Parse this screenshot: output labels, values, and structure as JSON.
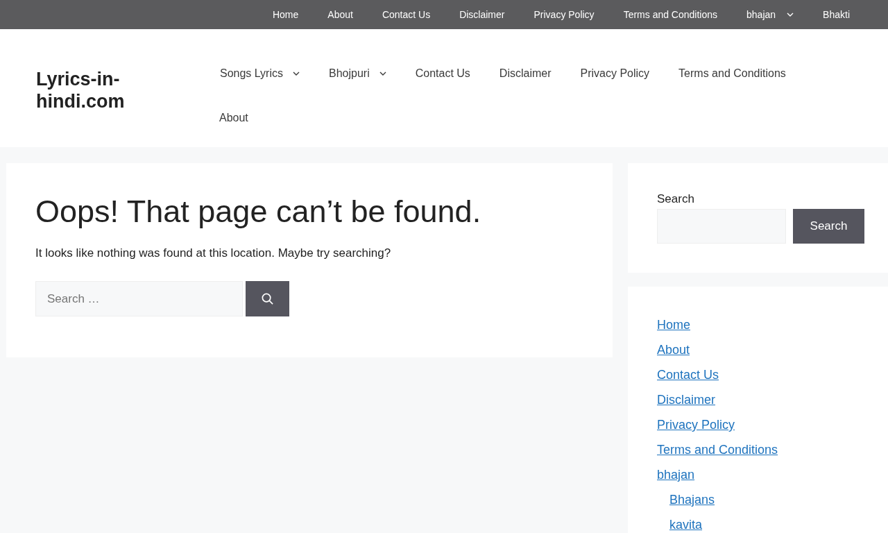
{
  "top_bar": {
    "items": [
      {
        "label": "Home",
        "has_submenu": false
      },
      {
        "label": "About",
        "has_submenu": false
      },
      {
        "label": "Contact Us",
        "has_submenu": false
      },
      {
        "label": "Disclaimer",
        "has_submenu": false
      },
      {
        "label": "Privacy Policy",
        "has_submenu": false
      },
      {
        "label": "Terms and Conditions",
        "has_submenu": false
      },
      {
        "label": "bhajan",
        "has_submenu": true
      },
      {
        "label": "Bhakti",
        "has_submenu": false
      }
    ]
  },
  "header": {
    "site_title": "Lyrics-in-hindi.com",
    "nav": [
      {
        "label": "Songs Lyrics",
        "has_submenu": true
      },
      {
        "label": "Bhojpuri",
        "has_submenu": true
      },
      {
        "label": "Contact Us",
        "has_submenu": false
      },
      {
        "label": "Disclaimer",
        "has_submenu": false
      },
      {
        "label": "Privacy Policy",
        "has_submenu": false
      },
      {
        "label": "Terms and Conditions",
        "has_submenu": false
      },
      {
        "label": "About",
        "has_submenu": false
      }
    ]
  },
  "main": {
    "heading": "Oops! That page can’t be found.",
    "message": "It looks like nothing was found at this location. Maybe try searching?",
    "search": {
      "placeholder": "Search …"
    }
  },
  "sidebar": {
    "search_widget": {
      "label": "Search",
      "button": "Search"
    },
    "pages": [
      {
        "label": "Home"
      },
      {
        "label": "About"
      },
      {
        "label": "Contact Us"
      },
      {
        "label": "Disclaimer"
      },
      {
        "label": "Privacy Policy"
      },
      {
        "label": "Terms and Conditions"
      },
      {
        "label": "bhajan",
        "children": [
          {
            "label": "Bhajans"
          },
          {
            "label": "kavita"
          }
        ]
      }
    ]
  }
}
